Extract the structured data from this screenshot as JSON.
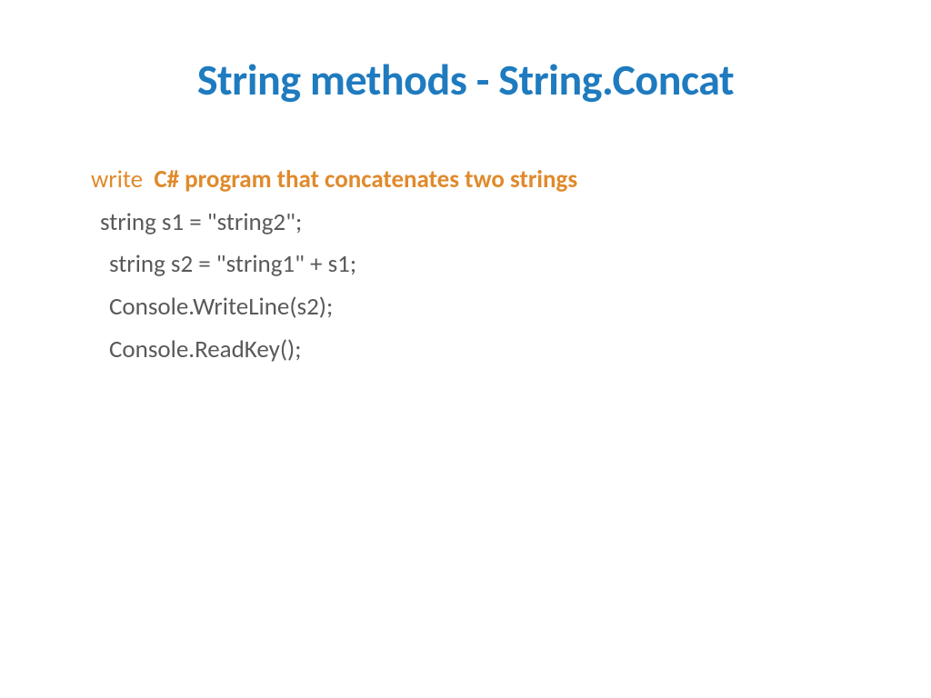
{
  "slide": {
    "title": "String methods - String.Concat",
    "prompt_prefix": "write",
    "prompt_text": "C# program that concatenates two strings",
    "code": {
      "line1": "string s1 = \"string2\";",
      "line2": "string s2 = \"string1\" + s1;",
      "line3": "Console.WriteLine(s2);",
      "line4": "Console.ReadKey();"
    }
  }
}
